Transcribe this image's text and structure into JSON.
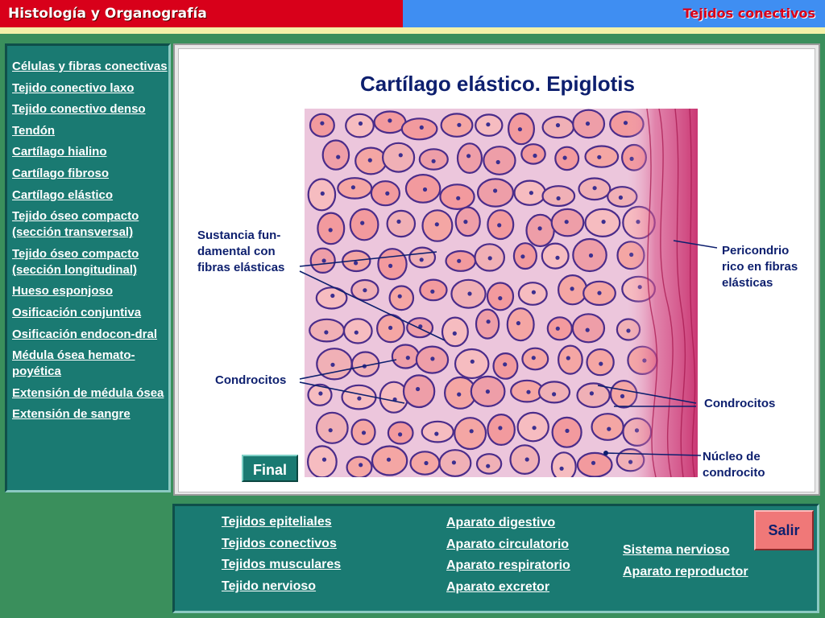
{
  "header": {
    "title": "Histología y Organografía",
    "section": "Tejidos conectivos"
  },
  "sidebar": {
    "items": [
      {
        "label": "Células y fibras conectivas"
      },
      {
        "label": "Tejido conectivo laxo"
      },
      {
        "label": "Tejido conectivo denso"
      },
      {
        "label": "Tendón"
      },
      {
        "label": "Cartílago hialino"
      },
      {
        "label": "Cartílago fibroso"
      },
      {
        "label": "Cartílago elástico"
      },
      {
        "label": "Tejido óseo compacto (sección transversal)"
      },
      {
        "label": "Tejido óseo compacto (sección longitudinal)"
      },
      {
        "label": "Hueso esponjoso"
      },
      {
        "label": "Osificación conjuntiva"
      },
      {
        "label": "Osificación endocon-dral"
      },
      {
        "label": "Médula ósea hemato-poyética"
      },
      {
        "label": "Extensión de médula ósea"
      },
      {
        "label": "Extensión de sangre"
      }
    ]
  },
  "main": {
    "title": "Cartílago elástico. Epiglotis",
    "labels": {
      "sustancia_1": "Sustancia fun-",
      "sustancia_2": "damental con",
      "sustancia_3": "fibras elásticas",
      "condrocitos_left": "Condrocitos",
      "pericondrio_1": "Pericondrio",
      "pericondrio_2": "rico en fibras",
      "pericondrio_3": "elásticas",
      "condrocitos_right": "Condrocitos",
      "nucleo_1": "Núcleo de",
      "nucleo_2": "condrocito"
    },
    "final_label": "Final"
  },
  "bottom_nav": {
    "col1": [
      "Tejidos epiteliales",
      "Tejidos conectivos",
      "Tejidos musculares",
      "Tejido nervioso"
    ],
    "col2": [
      "Aparato digestivo",
      "Aparato circulatorio",
      "Aparato respiratorio",
      "Aparato excretor"
    ],
    "col3": [
      "Sistema nervioso",
      "Aparato reproductor"
    ],
    "salir_label": "Salir"
  },
  "colors": {
    "header_red": "#d8001a",
    "header_blue": "#3f8ef2",
    "panel_teal": "#1a7a72",
    "background_green": "#3a8f5c",
    "label_navy": "#0d1f6e",
    "salir_pink": "#f07878"
  }
}
